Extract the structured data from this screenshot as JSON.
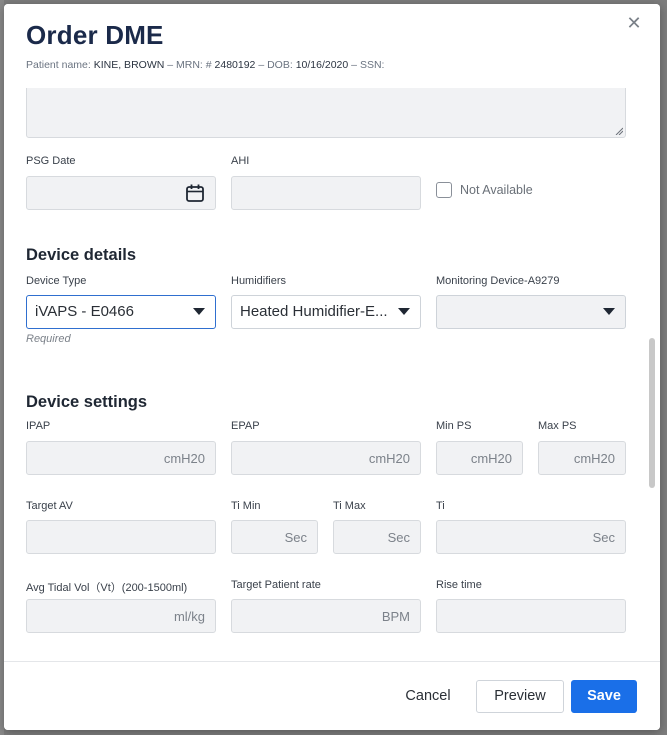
{
  "modal": {
    "title": "Order DME",
    "close_glyph": "✕",
    "patient": {
      "name_label": "Patient name:",
      "name_value": "KINE, BROWN",
      "sep1": "–",
      "mrn_label": "MRN: #",
      "mrn_value": "2480192",
      "sep2": "–",
      "dob_label": "DOB:",
      "dob_value": "10/16/2020",
      "sep3": "–",
      "ssn_label": "SSN:",
      "ssn_value": ""
    }
  },
  "study": {
    "psg_date": {
      "label": "PSG Date",
      "value": ""
    },
    "ahi": {
      "label": "AHI",
      "value": ""
    },
    "not_available": {
      "label": "Not Available",
      "checked": false
    }
  },
  "device_details": {
    "heading": "Device details",
    "device_type": {
      "label": "Device Type",
      "value": "iVAPS - E0466",
      "hint": "Required"
    },
    "humidifiers": {
      "label": "Humidifiers",
      "value": "Heated Humidifier-E..."
    },
    "monitoring": {
      "label": "Monitoring Device-A9279",
      "value": ""
    }
  },
  "device_settings": {
    "heading": "Device settings",
    "ipap": {
      "label": "IPAP",
      "unit": "cmH20"
    },
    "epap": {
      "label": "EPAP",
      "unit": "cmH20"
    },
    "min_ps": {
      "label": "Min PS",
      "unit": "cmH20"
    },
    "max_ps": {
      "label": "Max PS",
      "unit": "cmH20"
    },
    "target_av": {
      "label": "Target AV",
      "unit": ""
    },
    "ti_min": {
      "label": "Ti Min",
      "unit": "Sec"
    },
    "ti_max": {
      "label": "Ti Max",
      "unit": "Sec"
    },
    "ti": {
      "label": "Ti",
      "unit": "Sec"
    },
    "avg_tidal": {
      "label": "Avg Tidal Vol（Vt）(200-1500ml)",
      "unit": "ml/kg"
    },
    "target_rate": {
      "label": "Target Patient rate",
      "unit": "BPM"
    },
    "rise_time": {
      "label": "Rise time",
      "unit": ""
    }
  },
  "footer": {
    "cancel": "Cancel",
    "preview": "Preview",
    "save": "Save"
  },
  "colors": {
    "primary": "#1a6fe8",
    "title": "#1b2a4a",
    "focus_border": "#2f6fcf"
  }
}
